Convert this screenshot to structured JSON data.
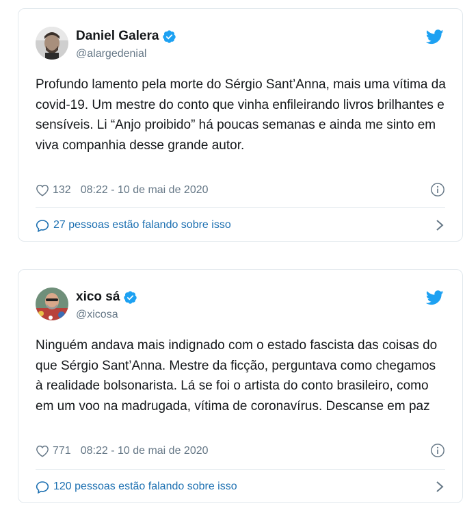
{
  "colors": {
    "twitter_blue": "#1da1f2",
    "link_blue": "#1b6fb1",
    "secondary_text": "#657786",
    "border": "#e1e8ed"
  },
  "tweets": [
    {
      "author": {
        "name": "Daniel Galera",
        "handle": "@alargedenial",
        "verified": true,
        "avatar_icon": "avatar-photo"
      },
      "text": "Profundo lamento pela morte do Sérgio Sant’Anna, mais uma vítima da covid-19. Um mestre do conto que vinha enfileirando livros brilhantes e sensíveis. Li “Anjo proibido” há poucas semanas e ainda me sinto em viva companhia desse grande autor.",
      "likes": "132",
      "timestamp": "08:22 - 10 de mai de 2020",
      "conversation": "27 pessoas estão falando sobre isso"
    },
    {
      "author": {
        "name": "xico sá",
        "handle": "@xicosa",
        "verified": true,
        "avatar_icon": "avatar-photo"
      },
      "text": "Ninguém andava mais indignado com o estado fascista das coisas do que Sérgio Sant’Anna. Mestre da ficção, perguntava como chegamos à realidade bolsonarista. Lá se foi o artista do conto brasileiro, como em um voo na madrugada, vítima de coronavírus. Descanse em paz",
      "likes": "771",
      "timestamp": "08:22 - 10 de mai de 2020",
      "conversation": "120 pessoas estão falando sobre isso"
    }
  ]
}
